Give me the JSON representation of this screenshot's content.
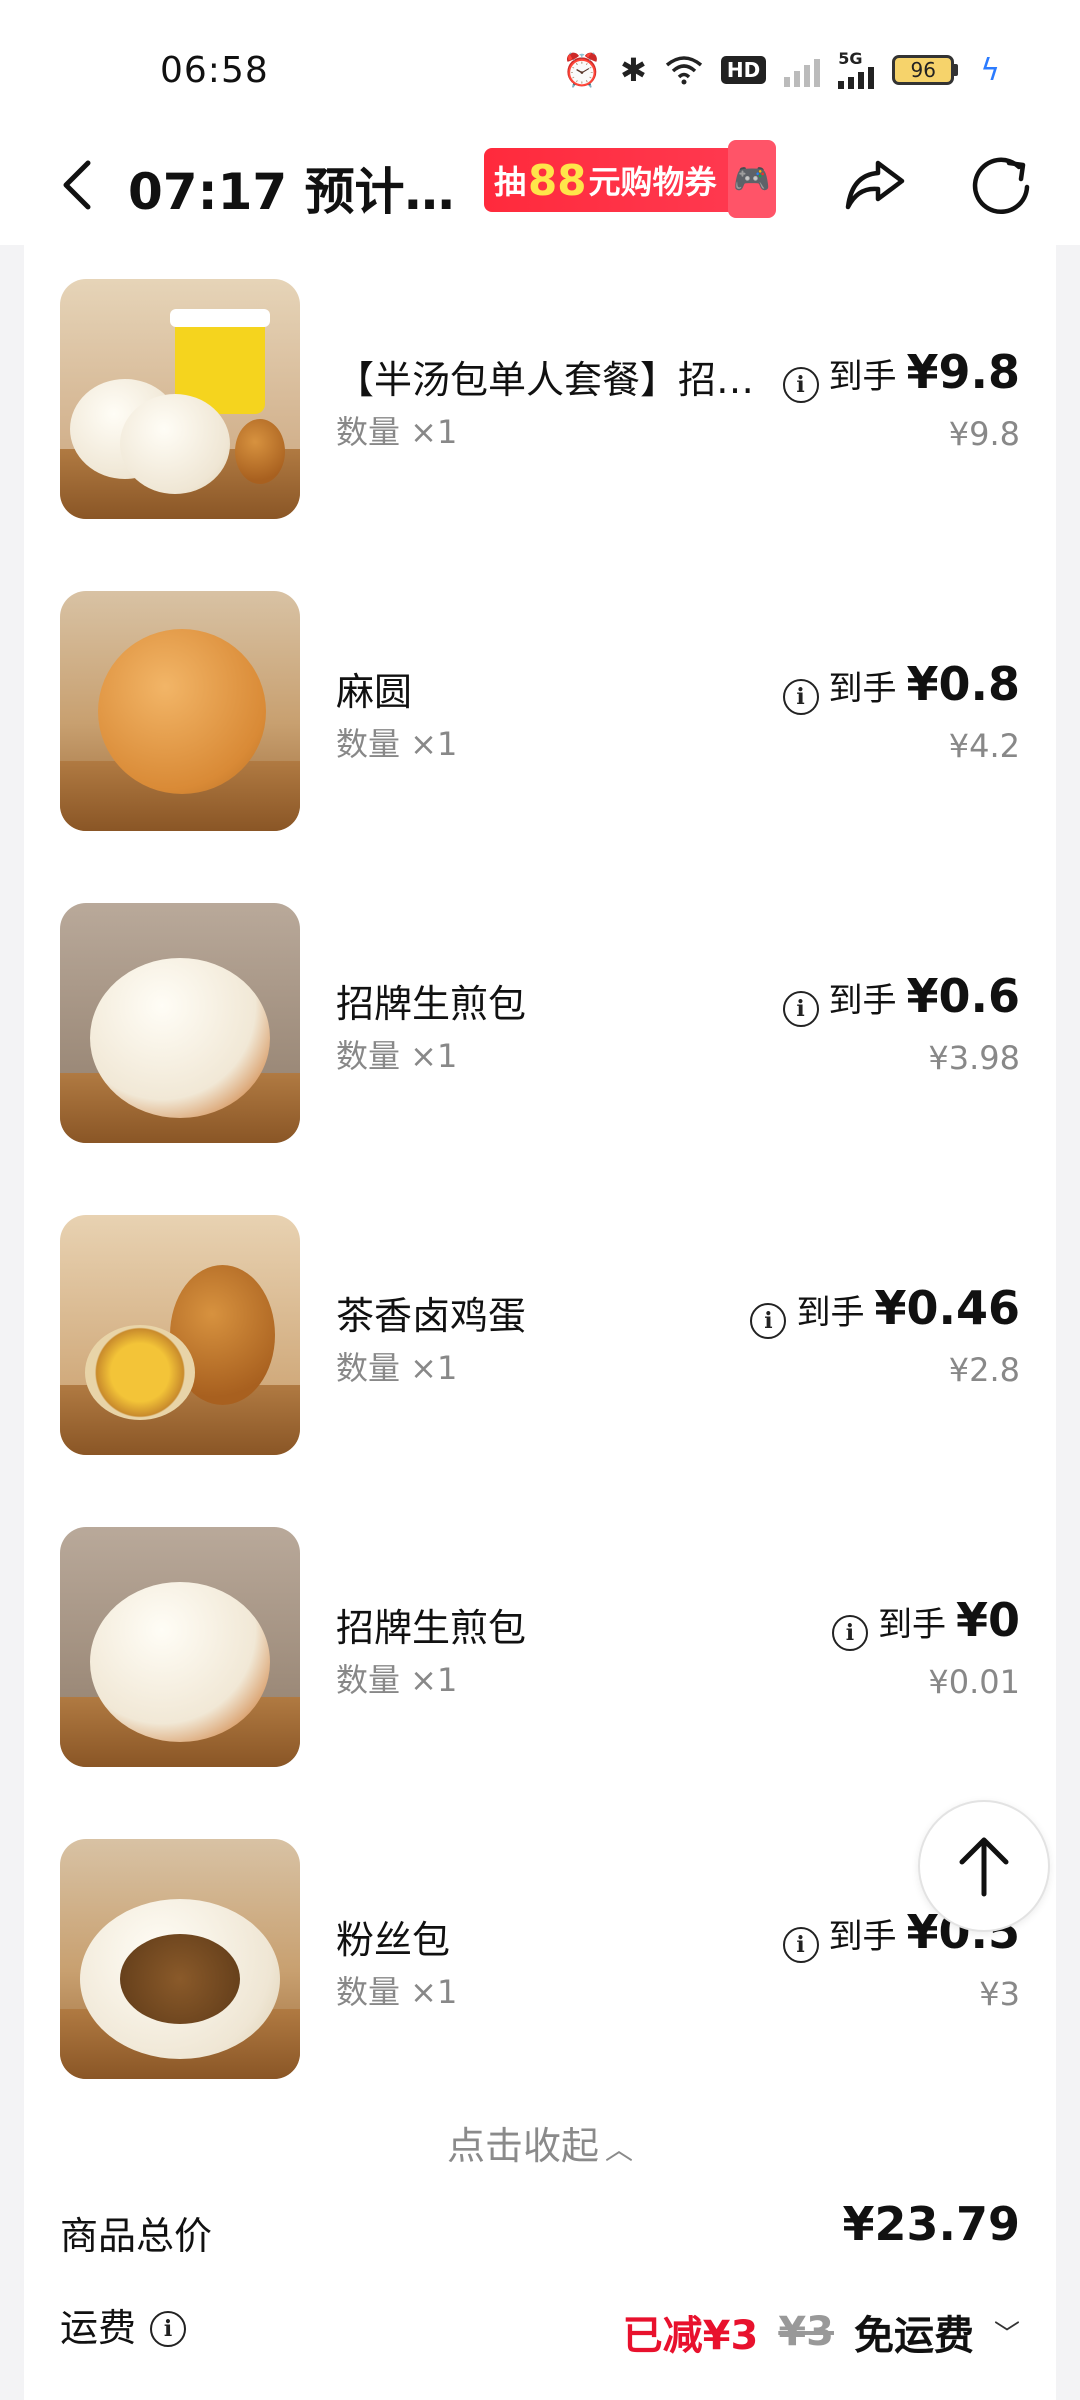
{
  "status_bar": {
    "time": "06:58",
    "icons": [
      "alarm-icon",
      "bluetooth-icon",
      "wifi-icon",
      "hd-icon",
      "signal-icon",
      "5g-signal-icon",
      "battery-icon",
      "charging-icon"
    ],
    "hd_label": "HD",
    "network_label": "5G",
    "battery_level": "96"
  },
  "nav": {
    "title": "07:17 预计…",
    "promo": {
      "prefix": "抽",
      "amount": "88",
      "suffix": "元购物券"
    }
  },
  "items": [
    {
      "name": "【半汤包单人套餐】招…",
      "qty": "数量 ×1",
      "label": "到手",
      "price": "¥9.8",
      "orig": "¥9.8"
    },
    {
      "name": "麻圆",
      "qty": "数量 ×1",
      "label": "到手",
      "price": "¥0.8",
      "orig": "¥4.2"
    },
    {
      "name": "招牌生煎包",
      "qty": "数量 ×1",
      "label": "到手",
      "price": "¥0.6",
      "orig": "¥3.98"
    },
    {
      "name": "茶香卤鸡蛋",
      "qty": "数量 ×1",
      "label": "到手",
      "price": "¥0.46",
      "orig": "¥2.8"
    },
    {
      "name": "招牌生煎包",
      "qty": "数量 ×1",
      "label": "到手",
      "price": "¥0",
      "orig": "¥0.01"
    },
    {
      "name": "粉丝包",
      "qty": "数量 ×1",
      "label": "到手",
      "price": "¥0.5",
      "orig": "¥3"
    }
  ],
  "collapse_label": "点击收起",
  "summary": {
    "total_label": "商品总价",
    "total_value": "¥23.79",
    "shipping_label": "运费",
    "shipping_reduced": "已减¥3",
    "shipping_original": "¥3",
    "shipping_free": "免运费"
  },
  "colors": {
    "accent_red": "#e8112d",
    "promo_red": "#ff2a3c",
    "promo_yellow": "#ffe54a"
  }
}
